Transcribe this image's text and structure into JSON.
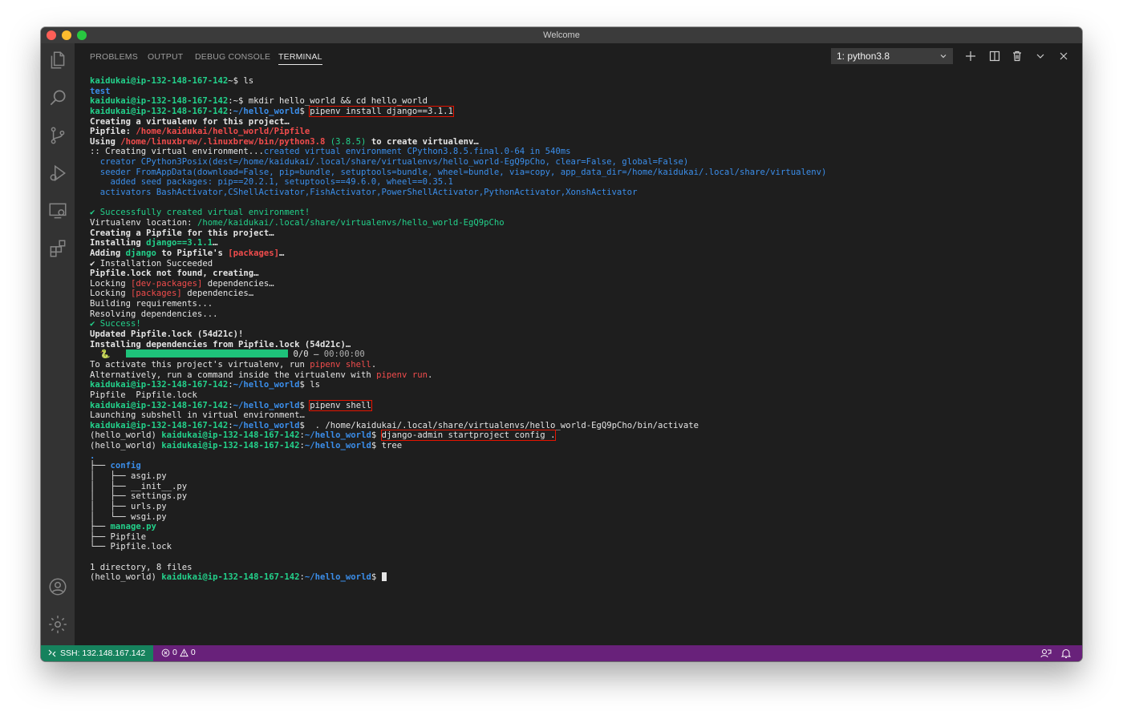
{
  "window": {
    "title": "Welcome"
  },
  "panel": {
    "tabs": [
      "PROBLEMS",
      "OUTPUT",
      "DEBUG CONSOLE",
      "TERMINAL"
    ],
    "active_tab": "TERMINAL",
    "terminal_select": "1: python3.8"
  },
  "status": {
    "remote": "SSH: 132.148.167.142",
    "errors": "0",
    "warnings": "0"
  },
  "colors": {
    "status_bar": "#68217a",
    "remote_badge": "#16825d",
    "highlight_box": "#e51400"
  },
  "terminal": {
    "lines": [
      [
        [
          "g",
          "kaidukai@ip-132-148-167-142"
        ],
        [
          "",
          "~$ ls"
        ]
      ],
      [
        [
          "b",
          "test"
        ]
      ],
      [
        [
          "g",
          "kaidukai@ip-132-148-167-142"
        ],
        [
          "",
          ":~$ mkdir hello_world && cd hello_world"
        ]
      ],
      [
        [
          "g",
          "kaidukai@ip-132-148-167-142"
        ],
        [
          "",
          ":"
        ],
        [
          "b",
          "~/hello_world"
        ],
        [
          "",
          "$ "
        ],
        [
          "hl",
          "pipenv install django==3.1.1"
        ]
      ],
      [
        [
          "w",
          "Creating a virtualenv for this project…"
        ]
      ],
      [
        [
          "w",
          "Pipfile: "
        ],
        [
          "rb",
          "/home/kaidukai/hello_world/Pipfile"
        ]
      ],
      [
        [
          "w",
          "Using "
        ],
        [
          "rb",
          "/home/linuxbrew/.linuxbrew/bin/python3.8"
        ],
        [
          "gn",
          " (3.8.5)"
        ],
        [
          "w",
          " to create virtualenv…"
        ]
      ],
      [
        [
          "",
          ":: Creating virtual environment..."
        ],
        [
          "bl",
          "created virtual environment CPython3.8.5.final.0-64 in 540ms"
        ]
      ],
      [
        [
          "bl",
          "  creator CPython3Posix(dest=/home/kaidukai/.local/share/virtualenvs/hello_world-EgQ9pCho, clear=False, global=False)"
        ]
      ],
      [
        [
          "bl",
          "  seeder FromAppData(download=False, pip=bundle, setuptools=bundle, wheel=bundle, via=copy, app_data_dir=/home/kaidukai/.local/share/virtualenv)"
        ]
      ],
      [
        [
          "bl",
          "    added seed packages: pip==20.2.1, setuptools==49.6.0, wheel==0.35.1"
        ]
      ],
      [
        [
          "bl",
          "  activators BashActivator,CShellActivator,FishActivator,PowerShellActivator,PythonActivator,XonshActivator"
        ]
      ],
      [
        [
          "",
          ""
        ]
      ],
      [
        [
          "gn",
          "✔ Successfully created virtual environment!"
        ]
      ],
      [
        [
          "",
          "Virtualenv location: "
        ],
        [
          "gn",
          "/home/kaidukai/.local/share/virtualenvs/hello_world-EgQ9pCho"
        ]
      ],
      [
        [
          "w",
          "Creating a Pipfile for this project…"
        ]
      ],
      [
        [
          "w",
          "Installing "
        ],
        [
          "g",
          "django==3.1.1"
        ],
        [
          "w",
          "…"
        ]
      ],
      [
        [
          "w",
          "Adding "
        ],
        [
          "g",
          "django"
        ],
        [
          "w",
          " to Pipfile's "
        ],
        [
          "rb",
          "[packages]"
        ],
        [
          "w",
          "…"
        ]
      ],
      [
        [
          "",
          "✔ Installation Succeeded"
        ]
      ],
      [
        [
          "w",
          "Pipfile.lock not found, creating…"
        ]
      ],
      [
        [
          "",
          "Locking "
        ],
        [
          "r",
          "[dev-packages]"
        ],
        [
          "",
          " dependencies…"
        ]
      ],
      [
        [
          "",
          "Locking "
        ],
        [
          "r",
          "[packages]"
        ],
        [
          "",
          " dependencies…"
        ]
      ],
      [
        [
          "",
          "Building requirements..."
        ]
      ],
      [
        [
          "",
          "Resolving dependencies..."
        ]
      ],
      [
        [
          "gn",
          "✔ Success!"
        ]
      ],
      [
        [
          "w",
          "Updated Pipfile.lock (54d21c)!"
        ]
      ],
      [
        [
          "w",
          "Installing dependencies from Pipfile.lock (54d21c)…"
        ]
      ],
      [
        [
          "",
          "  🐍   "
        ],
        [
          "bar",
          ""
        ],
        [
          "",
          " 0/0 — "
        ],
        [
          "dim",
          "00:00:00"
        ]
      ],
      [
        [
          "",
          "To activate this project's virtualenv, run "
        ],
        [
          "r",
          "pipenv shell"
        ],
        [
          "",
          "."
        ]
      ],
      [
        [
          "",
          "Alternatively, run a command inside the virtualenv with "
        ],
        [
          "r",
          "pipenv run"
        ],
        [
          "",
          "."
        ]
      ],
      [
        [
          "g",
          "kaidukai@ip-132-148-167-142"
        ],
        [
          "",
          ":"
        ],
        [
          "b",
          "~/hello_world"
        ],
        [
          "",
          "$ ls"
        ]
      ],
      [
        [
          "",
          "Pipfile  Pipfile.lock"
        ]
      ],
      [
        [
          "g",
          "kaidukai@ip-132-148-167-142"
        ],
        [
          "",
          ":"
        ],
        [
          "b",
          "~/hello_world"
        ],
        [
          "",
          "$ "
        ],
        [
          "hl",
          "pipenv shell"
        ]
      ],
      [
        [
          "",
          "Launching subshell in virtual environment…"
        ]
      ],
      [
        [
          "g",
          "kaidukai@ip-132-148-167-142"
        ],
        [
          "",
          ":"
        ],
        [
          "b",
          "~/hello_world"
        ],
        [
          "",
          "$  . /home/kaidukai/.local/share/virtualenvs/hello_world-EgQ9pCho/bin/activate"
        ]
      ],
      [
        [
          "",
          "(hello_world) "
        ],
        [
          "g",
          "kaidukai@ip-132-148-167-142"
        ],
        [
          "",
          ":"
        ],
        [
          "b",
          "~/hello_world"
        ],
        [
          "",
          "$ "
        ],
        [
          "hl",
          "django-admin startproject config ."
        ]
      ],
      [
        [
          "",
          "(hello_world) "
        ],
        [
          "g",
          "kaidukai@ip-132-148-167-142"
        ],
        [
          "",
          ":"
        ],
        [
          "b",
          "~/hello_world"
        ],
        [
          "",
          "$ tree"
        ]
      ],
      [
        [
          "b",
          "."
        ]
      ],
      [
        [
          "",
          "├── "
        ],
        [
          "b",
          "config"
        ]
      ],
      [
        [
          "",
          "│   ├── asgi.py"
        ]
      ],
      [
        [
          "",
          "│   ├── __init__.py"
        ]
      ],
      [
        [
          "",
          "│   ├── settings.py"
        ]
      ],
      [
        [
          "",
          "│   ├── urls.py"
        ]
      ],
      [
        [
          "",
          "│   └── wsgi.py"
        ]
      ],
      [
        [
          "",
          "├── "
        ],
        [
          "g",
          "manage.py"
        ]
      ],
      [
        [
          "",
          "├── Pipfile"
        ]
      ],
      [
        [
          "",
          "└── Pipfile.lock"
        ]
      ],
      [
        [
          "",
          ""
        ]
      ],
      [
        [
          "",
          "1 directory, 8 files"
        ]
      ],
      [
        [
          "",
          "(hello_world) "
        ],
        [
          "g",
          "kaidukai@ip-132-148-167-142"
        ],
        [
          "",
          ":"
        ],
        [
          "b",
          "~/hello_world"
        ],
        [
          "",
          "$ "
        ],
        [
          "cursor",
          ""
        ]
      ]
    ]
  }
}
